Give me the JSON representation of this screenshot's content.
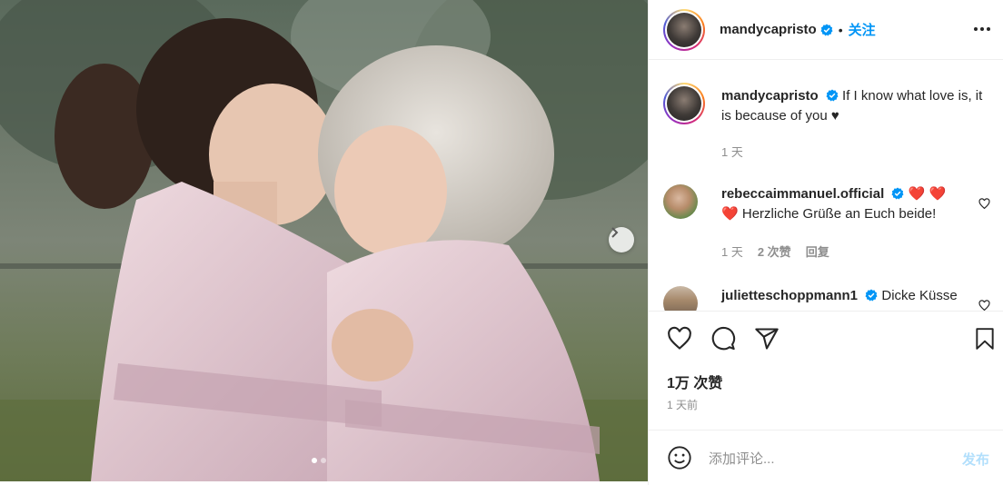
{
  "post": {
    "username": "mandycapristo",
    "follow_label": "关注",
    "separator": "•",
    "caption": "If I know what love is, it is because of you ♥",
    "caption_time": "1 天",
    "carousel": {
      "dots": 2,
      "active_dot": 1
    }
  },
  "comments": [
    {
      "username": "rebeccaimmanuel.official",
      "text_hearts": "❤️ ❤️",
      "text_prefix": "❤️",
      "text": "Herzliche Grüße an Euch beide!",
      "time": "1 天",
      "likes": "2 次赞",
      "reply": "回复"
    },
    {
      "username": "julietteschoppmann1",
      "text": "Dicke Küsse"
    }
  ],
  "stats": {
    "likes": "1万 次赞",
    "time": "1 天前"
  },
  "composer": {
    "placeholder": "添加评论...",
    "post_label": "发布"
  },
  "icons": [
    "verified-badge-icon",
    "more-icon",
    "heart-icon",
    "comment-icon",
    "share-icon",
    "bookmark-icon",
    "emoji-icon",
    "chevron-right-icon"
  ],
  "colors": {
    "accent": "#0095f6",
    "text": "#262626",
    "muted": "#8e8e8e",
    "verified": "#0095f6"
  }
}
